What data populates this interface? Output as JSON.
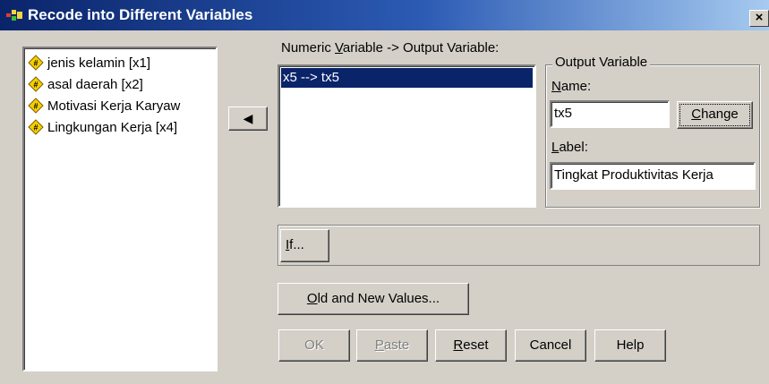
{
  "window": {
    "title": "Recode into Different Variables",
    "close_label": "×"
  },
  "source_list": {
    "items": [
      {
        "label": "jenis kelamin [x1]"
      },
      {
        "label": "asal daerah [x2]"
      },
      {
        "label": "Motivasi Kerja Karyaw"
      },
      {
        "label": "Lingkungan Kerja [x4]"
      }
    ]
  },
  "transfer_button": {
    "glyph": "◀"
  },
  "mapping": {
    "header_pre": "Numeric ",
    "header_u": "V",
    "header_post": "ariable -> Output Variable:",
    "selected_row": "x5 --> tx5"
  },
  "output_variable": {
    "group_title": "Output Variable",
    "name_u": "N",
    "name_rest": "ame:",
    "name_value": "tx5",
    "change_u": "C",
    "change_rest": "hange",
    "label_u": "L",
    "label_rest": "abel:",
    "label_value": "Tingkat Produktivitas Kerja"
  },
  "if_button": {
    "u": "I",
    "rest": "f..."
  },
  "old_new_button": {
    "u": "O",
    "rest": "ld and New Values..."
  },
  "footer": {
    "ok": "OK",
    "paste_u": "P",
    "paste_rest": "aste",
    "reset_u": "R",
    "reset_rest": "eset",
    "cancel": "Cancel",
    "help": "Help"
  },
  "colors": {
    "title_start": "#0a246a",
    "title_end": "#a6caf0",
    "selection": "#0a246a",
    "face": "#d4d0c8"
  }
}
